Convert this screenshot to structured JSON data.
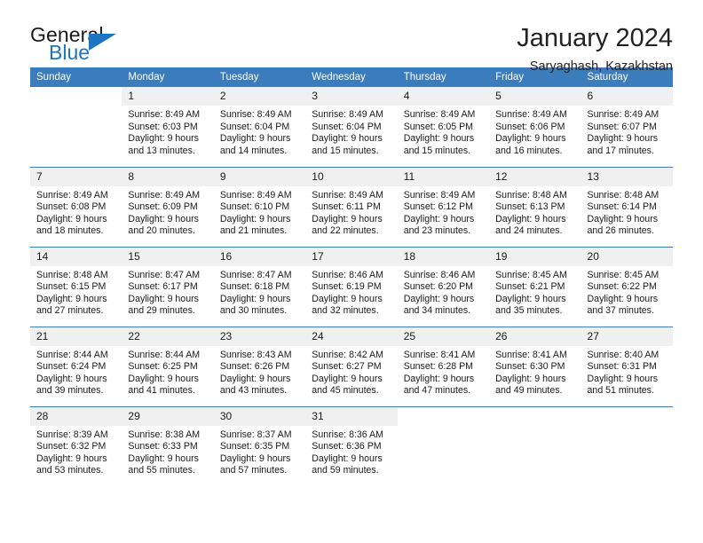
{
  "brand": {
    "name_top": "General",
    "name_bottom": "Blue",
    "accent_color": "#1d74c0"
  },
  "header": {
    "title": "January 2024",
    "subtitle": "Saryaghash, Kazakhstan"
  },
  "theme": {
    "header_bg": "#3b7cbd",
    "daynum_bg": "#f0f0f0",
    "text": "#1a1a1a"
  },
  "calendar": {
    "weekday_headers": [
      "Sunday",
      "Monday",
      "Tuesday",
      "Wednesday",
      "Thursday",
      "Friday",
      "Saturday"
    ],
    "weeks": [
      [
        {
          "day": "",
          "sunrise": "",
          "sunset": "",
          "daylight_line1": "",
          "daylight_line2": ""
        },
        {
          "day": "1",
          "sunrise": "Sunrise: 8:49 AM",
          "sunset": "Sunset: 6:03 PM",
          "daylight_line1": "Daylight: 9 hours",
          "daylight_line2": "and 13 minutes."
        },
        {
          "day": "2",
          "sunrise": "Sunrise: 8:49 AM",
          "sunset": "Sunset: 6:04 PM",
          "daylight_line1": "Daylight: 9 hours",
          "daylight_line2": "and 14 minutes."
        },
        {
          "day": "3",
          "sunrise": "Sunrise: 8:49 AM",
          "sunset": "Sunset: 6:04 PM",
          "daylight_line1": "Daylight: 9 hours",
          "daylight_line2": "and 15 minutes."
        },
        {
          "day": "4",
          "sunrise": "Sunrise: 8:49 AM",
          "sunset": "Sunset: 6:05 PM",
          "daylight_line1": "Daylight: 9 hours",
          "daylight_line2": "and 15 minutes."
        },
        {
          "day": "5",
          "sunrise": "Sunrise: 8:49 AM",
          "sunset": "Sunset: 6:06 PM",
          "daylight_line1": "Daylight: 9 hours",
          "daylight_line2": "and 16 minutes."
        },
        {
          "day": "6",
          "sunrise": "Sunrise: 8:49 AM",
          "sunset": "Sunset: 6:07 PM",
          "daylight_line1": "Daylight: 9 hours",
          "daylight_line2": "and 17 minutes."
        }
      ],
      [
        {
          "day": "7",
          "sunrise": "Sunrise: 8:49 AM",
          "sunset": "Sunset: 6:08 PM",
          "daylight_line1": "Daylight: 9 hours",
          "daylight_line2": "and 18 minutes."
        },
        {
          "day": "8",
          "sunrise": "Sunrise: 8:49 AM",
          "sunset": "Sunset: 6:09 PM",
          "daylight_line1": "Daylight: 9 hours",
          "daylight_line2": "and 20 minutes."
        },
        {
          "day": "9",
          "sunrise": "Sunrise: 8:49 AM",
          "sunset": "Sunset: 6:10 PM",
          "daylight_line1": "Daylight: 9 hours",
          "daylight_line2": "and 21 minutes."
        },
        {
          "day": "10",
          "sunrise": "Sunrise: 8:49 AM",
          "sunset": "Sunset: 6:11 PM",
          "daylight_line1": "Daylight: 9 hours",
          "daylight_line2": "and 22 minutes."
        },
        {
          "day": "11",
          "sunrise": "Sunrise: 8:49 AM",
          "sunset": "Sunset: 6:12 PM",
          "daylight_line1": "Daylight: 9 hours",
          "daylight_line2": "and 23 minutes."
        },
        {
          "day": "12",
          "sunrise": "Sunrise: 8:48 AM",
          "sunset": "Sunset: 6:13 PM",
          "daylight_line1": "Daylight: 9 hours",
          "daylight_line2": "and 24 minutes."
        },
        {
          "day": "13",
          "sunrise": "Sunrise: 8:48 AM",
          "sunset": "Sunset: 6:14 PM",
          "daylight_line1": "Daylight: 9 hours",
          "daylight_line2": "and 26 minutes."
        }
      ],
      [
        {
          "day": "14",
          "sunrise": "Sunrise: 8:48 AM",
          "sunset": "Sunset: 6:15 PM",
          "daylight_line1": "Daylight: 9 hours",
          "daylight_line2": "and 27 minutes."
        },
        {
          "day": "15",
          "sunrise": "Sunrise: 8:47 AM",
          "sunset": "Sunset: 6:17 PM",
          "daylight_line1": "Daylight: 9 hours",
          "daylight_line2": "and 29 minutes."
        },
        {
          "day": "16",
          "sunrise": "Sunrise: 8:47 AM",
          "sunset": "Sunset: 6:18 PM",
          "daylight_line1": "Daylight: 9 hours",
          "daylight_line2": "and 30 minutes."
        },
        {
          "day": "17",
          "sunrise": "Sunrise: 8:46 AM",
          "sunset": "Sunset: 6:19 PM",
          "daylight_line1": "Daylight: 9 hours",
          "daylight_line2": "and 32 minutes."
        },
        {
          "day": "18",
          "sunrise": "Sunrise: 8:46 AM",
          "sunset": "Sunset: 6:20 PM",
          "daylight_line1": "Daylight: 9 hours",
          "daylight_line2": "and 34 minutes."
        },
        {
          "day": "19",
          "sunrise": "Sunrise: 8:45 AM",
          "sunset": "Sunset: 6:21 PM",
          "daylight_line1": "Daylight: 9 hours",
          "daylight_line2": "and 35 minutes."
        },
        {
          "day": "20",
          "sunrise": "Sunrise: 8:45 AM",
          "sunset": "Sunset: 6:22 PM",
          "daylight_line1": "Daylight: 9 hours",
          "daylight_line2": "and 37 minutes."
        }
      ],
      [
        {
          "day": "21",
          "sunrise": "Sunrise: 8:44 AM",
          "sunset": "Sunset: 6:24 PM",
          "daylight_line1": "Daylight: 9 hours",
          "daylight_line2": "and 39 minutes."
        },
        {
          "day": "22",
          "sunrise": "Sunrise: 8:44 AM",
          "sunset": "Sunset: 6:25 PM",
          "daylight_line1": "Daylight: 9 hours",
          "daylight_line2": "and 41 minutes."
        },
        {
          "day": "23",
          "sunrise": "Sunrise: 8:43 AM",
          "sunset": "Sunset: 6:26 PM",
          "daylight_line1": "Daylight: 9 hours",
          "daylight_line2": "and 43 minutes."
        },
        {
          "day": "24",
          "sunrise": "Sunrise: 8:42 AM",
          "sunset": "Sunset: 6:27 PM",
          "daylight_line1": "Daylight: 9 hours",
          "daylight_line2": "and 45 minutes."
        },
        {
          "day": "25",
          "sunrise": "Sunrise: 8:41 AM",
          "sunset": "Sunset: 6:28 PM",
          "daylight_line1": "Daylight: 9 hours",
          "daylight_line2": "and 47 minutes."
        },
        {
          "day": "26",
          "sunrise": "Sunrise: 8:41 AM",
          "sunset": "Sunset: 6:30 PM",
          "daylight_line1": "Daylight: 9 hours",
          "daylight_line2": "and 49 minutes."
        },
        {
          "day": "27",
          "sunrise": "Sunrise: 8:40 AM",
          "sunset": "Sunset: 6:31 PM",
          "daylight_line1": "Daylight: 9 hours",
          "daylight_line2": "and 51 minutes."
        }
      ],
      [
        {
          "day": "28",
          "sunrise": "Sunrise: 8:39 AM",
          "sunset": "Sunset: 6:32 PM",
          "daylight_line1": "Daylight: 9 hours",
          "daylight_line2": "and 53 minutes."
        },
        {
          "day": "29",
          "sunrise": "Sunrise: 8:38 AM",
          "sunset": "Sunset: 6:33 PM",
          "daylight_line1": "Daylight: 9 hours",
          "daylight_line2": "and 55 minutes."
        },
        {
          "day": "30",
          "sunrise": "Sunrise: 8:37 AM",
          "sunset": "Sunset: 6:35 PM",
          "daylight_line1": "Daylight: 9 hours",
          "daylight_line2": "and 57 minutes."
        },
        {
          "day": "31",
          "sunrise": "Sunrise: 8:36 AM",
          "sunset": "Sunset: 6:36 PM",
          "daylight_line1": "Daylight: 9 hours",
          "daylight_line2": "and 59 minutes."
        },
        {
          "day": "",
          "sunrise": "",
          "sunset": "",
          "daylight_line1": "",
          "daylight_line2": ""
        },
        {
          "day": "",
          "sunrise": "",
          "sunset": "",
          "daylight_line1": "",
          "daylight_line2": ""
        },
        {
          "day": "",
          "sunrise": "",
          "sunset": "",
          "daylight_line1": "",
          "daylight_line2": ""
        }
      ]
    ]
  }
}
